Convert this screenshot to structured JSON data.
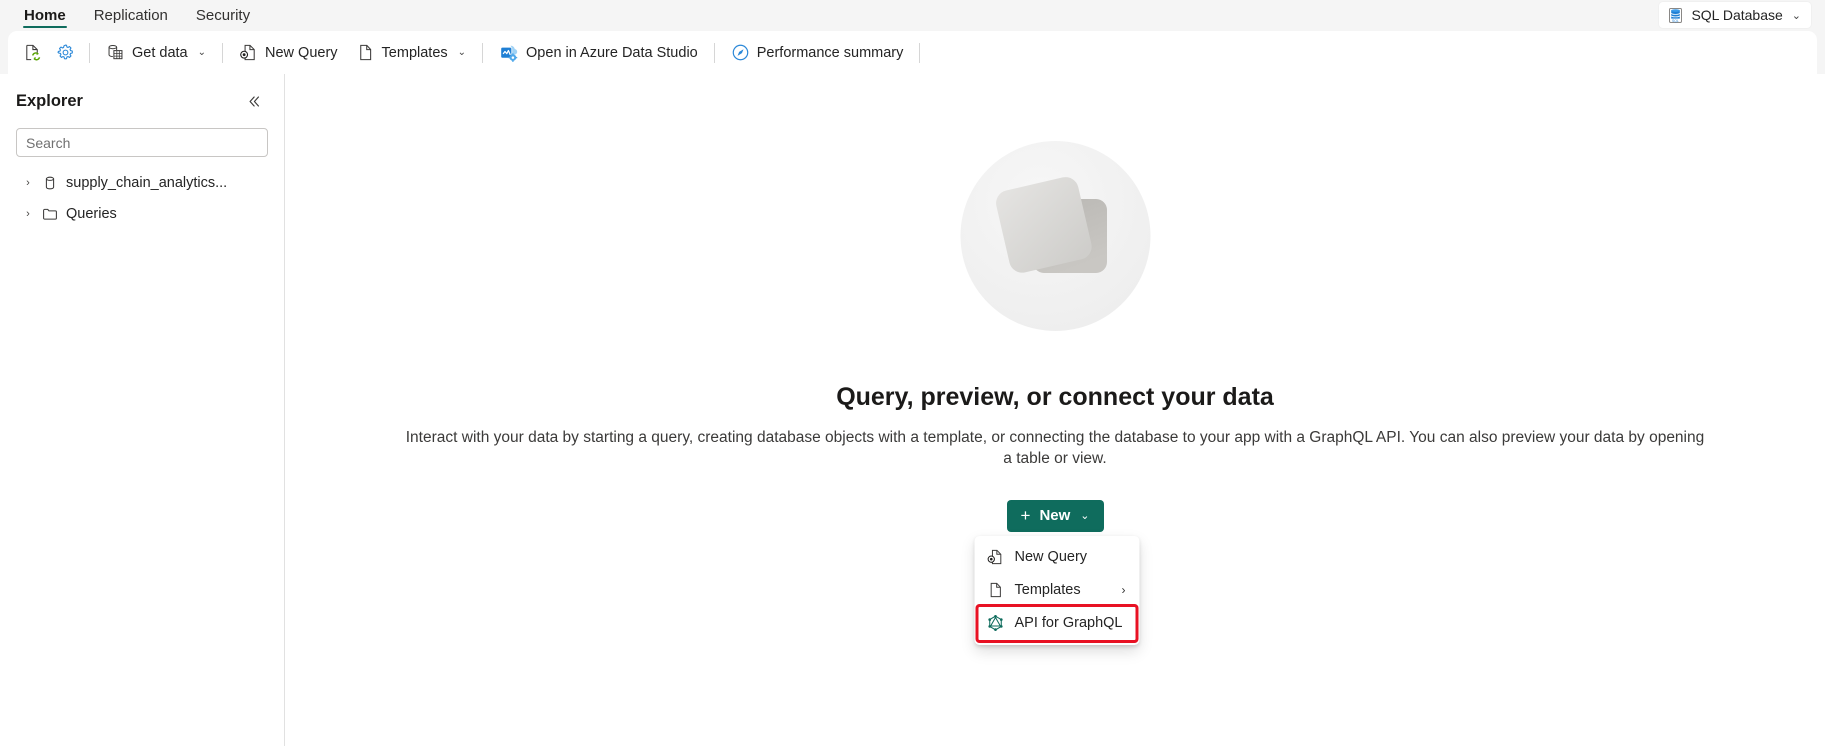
{
  "tabs": [
    {
      "label": "Home",
      "active": true
    },
    {
      "label": "Replication",
      "active": false
    },
    {
      "label": "Security",
      "active": false
    }
  ],
  "db_pill": {
    "label": "SQL Database",
    "chevron": "⌄",
    "icon": "database-icon"
  },
  "toolbar": {
    "refresh_icon": "refresh-page-icon",
    "settings_icon": "gear-icon",
    "items": [
      {
        "label": "Get data",
        "icon": "get-data-icon",
        "chevron": "⌄"
      },
      {
        "label": "New Query",
        "icon": "new-query-icon",
        "chevron": ""
      },
      {
        "label": "Templates",
        "icon": "template-page-icon",
        "chevron": "⌄"
      },
      {
        "label": "Open in Azure Data Studio",
        "icon": "azure-data-studio-icon",
        "chevron": ""
      },
      {
        "label": "Performance summary",
        "icon": "gauge-icon",
        "chevron": ""
      }
    ]
  },
  "sidebar": {
    "title": "Explorer",
    "collapse_icon": "chevron-double-left-icon",
    "search": {
      "placeholder": "Search",
      "value": ""
    },
    "tree": [
      {
        "label": "supply_chain_analytics...",
        "icon": "database-icon",
        "expander": "›"
      },
      {
        "label": "Queries",
        "icon": "folder-icon",
        "expander": "›"
      }
    ]
  },
  "content": {
    "illustration": "overlapping-squares-illustration",
    "title": "Query, preview, or connect your data",
    "description": "Interact with your data by starting a query, creating database objects with a template, or connecting the database to your app with a GraphQL API. You can also preview your data by opening a table or view.",
    "new_button": {
      "label": "New",
      "plus": "+",
      "chevron": "⌄"
    },
    "menu": [
      {
        "label": "New Query",
        "icon": "new-query-icon",
        "submenu": "",
        "highlighted": false
      },
      {
        "label": "Templates",
        "icon": "template-page-icon",
        "submenu": "›",
        "highlighted": false
      },
      {
        "label": "API for GraphQL",
        "icon": "graphql-icon",
        "submenu": "",
        "highlighted": true
      }
    ]
  },
  "colors": {
    "accent_green": "#0f6c5d",
    "annotation_red": "#e81123",
    "icon_blue": "#0078d4",
    "icon_green": "#57a300",
    "page_bg": "#f5f5f5"
  }
}
